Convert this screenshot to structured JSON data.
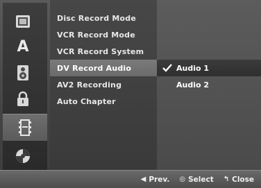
{
  "sidebar": {
    "icons": [
      {
        "name": "disc-icon"
      },
      {
        "name": "language-icon",
        "glyph": "A"
      },
      {
        "name": "audio-speaker-icon"
      },
      {
        "name": "lock-icon"
      },
      {
        "name": "recording-film-icon"
      },
      {
        "name": "others-icon"
      }
    ],
    "active_index": 4
  },
  "menu": {
    "items": [
      "Disc Record Mode",
      "VCR Record Mode",
      "VCR Record System",
      "DV Record Audio",
      "AV2 Recording",
      "Auto Chapter"
    ],
    "selected_index": 3
  },
  "options": {
    "items": [
      "Audio 1",
      "Audio 2"
    ],
    "checked_index": 0
  },
  "footer": {
    "prev_label": "Prev.",
    "select_label": "Select",
    "close_label": "Close"
  },
  "colors": {
    "background": "#454545",
    "highlight": "#727272",
    "text": "#e8e8e8"
  }
}
